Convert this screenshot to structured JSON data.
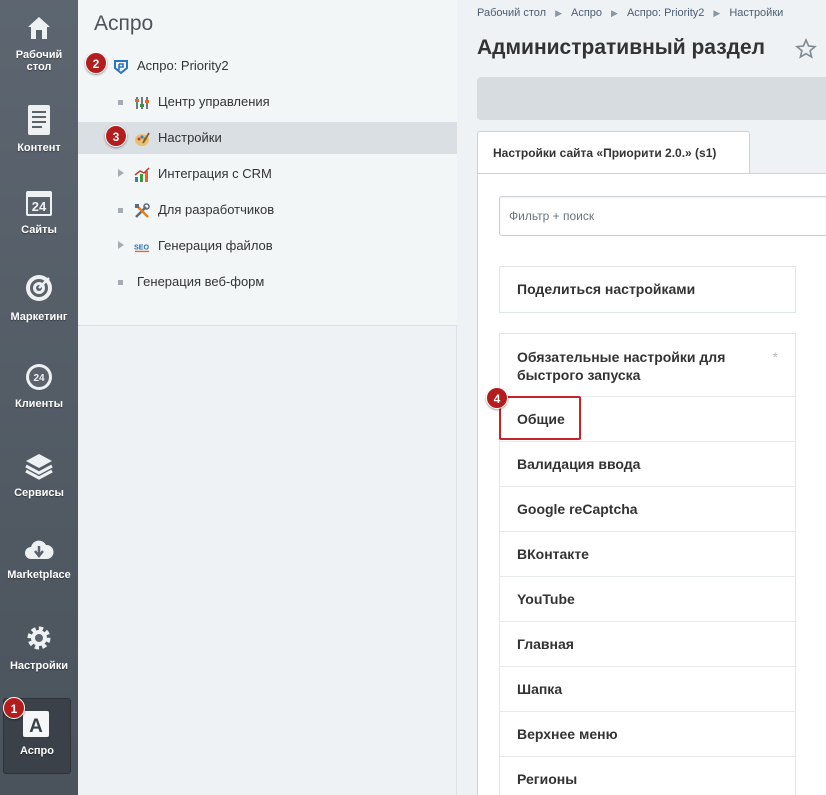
{
  "rail": {
    "items": [
      {
        "label": "Рабочий\nстол",
        "icon": "home-icon"
      },
      {
        "label": "Контент",
        "icon": "document-icon"
      },
      {
        "label": "Сайты",
        "icon": "calendar-24-icon"
      },
      {
        "label": "Маркетинг",
        "icon": "target-icon"
      },
      {
        "label": "Клиенты",
        "icon": "clients-24-icon"
      },
      {
        "label": "Сервисы",
        "icon": "layers-icon"
      },
      {
        "label": "Marketplace",
        "icon": "cloud-download-icon"
      },
      {
        "label": "Настройки",
        "icon": "gear-icon"
      },
      {
        "label": "Аспро",
        "icon": "aspro-a-icon"
      }
    ],
    "badge": "1"
  },
  "menu": {
    "title": "Аспро",
    "items": [
      {
        "label": "Аспро: Priority2",
        "icon": "priority-logo-icon",
        "badge": "2"
      },
      {
        "label": "Центр управления",
        "icon": "control-center-icon"
      },
      {
        "label": "Настройки",
        "icon": "palette-icon",
        "badge": "3"
      },
      {
        "label": "Интеграция с CRM",
        "icon": "chart-icon"
      },
      {
        "label": "Для разработчиков",
        "icon": "tools-icon"
      },
      {
        "label": "Генерация файлов",
        "icon": "seo-icon"
      },
      {
        "label": "Генерация веб-форм",
        "icon": ""
      }
    ]
  },
  "main": {
    "breadcrumb": [
      "Рабочий стол",
      "Аспро",
      "Аспро: Priority2",
      "Настройки"
    ],
    "title": "Административный раздел",
    "tab": "Настройки сайта «Приорити 2.0.» (s1)",
    "filter_placeholder": "Фильтр + поиск",
    "share": "Поделиться настройками",
    "sections": [
      "Обязательные настройки для быстрого запуска",
      "Общие",
      "Валидация ввода",
      "Google reCaptcha",
      "ВКонтакте",
      "YouTube",
      "Главная",
      "Шапка",
      "Верхнее меню",
      "Регионы"
    ],
    "pin_symbol": "*",
    "highlight_badge": "4"
  },
  "colors": {
    "rail_bg": "#5d6670",
    "badge": "#b31d1d",
    "highlight": "#c4252b",
    "selected_row": "#d9dfe3"
  }
}
